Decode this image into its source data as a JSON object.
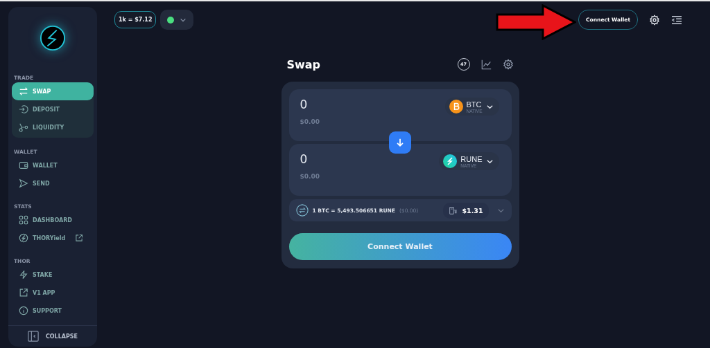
{
  "sidebar": {
    "groups": [
      {
        "label": "TRADE",
        "items": [
          {
            "label": "SWAP",
            "selected": true
          },
          {
            "label": "DEPOSIT",
            "selected": false
          },
          {
            "label": "LIQUIDITY",
            "selected": false
          }
        ]
      },
      {
        "label": "WALLET",
        "items": [
          {
            "label": "WALLET",
            "selected": false
          },
          {
            "label": "SEND",
            "selected": false
          }
        ]
      },
      {
        "label": "STATS",
        "items": [
          {
            "label": "DASHBOARD",
            "selected": false
          },
          {
            "label": "THORYield",
            "selected": false,
            "external": true
          }
        ]
      },
      {
        "label": "THOR",
        "items": [
          {
            "label": "STAKE",
            "selected": false
          },
          {
            "label": "V1 APP",
            "selected": false
          },
          {
            "label": "SUPPORT",
            "selected": false
          }
        ]
      }
    ],
    "collapse": "COLLAPSE"
  },
  "topbar": {
    "price": "1k = $7.12",
    "online": true,
    "connect": "Connect Wallet"
  },
  "swap": {
    "title": "Swap",
    "badge": "47",
    "from": {
      "amount": "0",
      "usd": "$0.00",
      "symbol": "BTC",
      "chain": "NATIVE"
    },
    "to": {
      "amount": "0",
      "usd": "$0.00",
      "symbol": "RUNE",
      "chain": "NATIVE"
    },
    "rate": "1 BTC = 5,493.506651 RUNE",
    "rate_usd": "($0.00)",
    "fee": "$1.31",
    "button": "Connect Wallet"
  }
}
